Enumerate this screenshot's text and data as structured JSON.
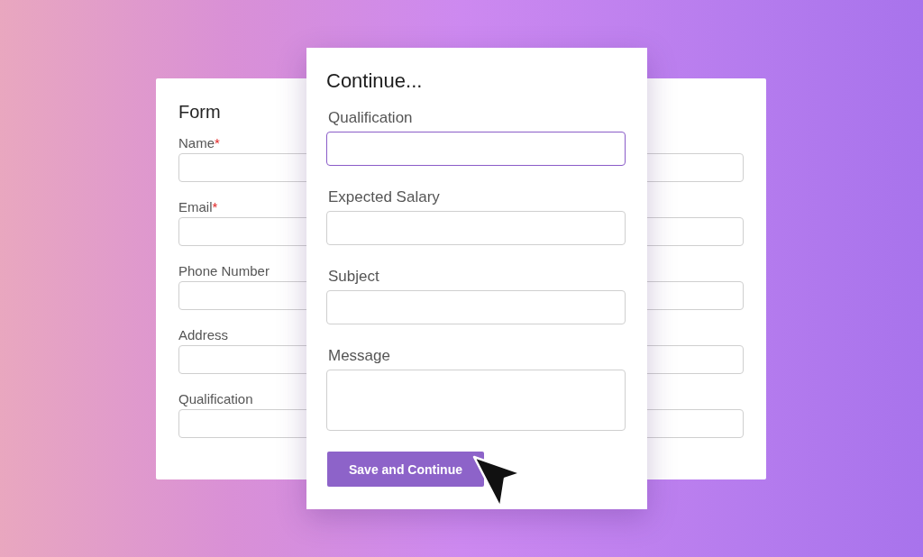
{
  "back_form": {
    "title": "Form",
    "fields": [
      {
        "label": "Name",
        "required_mark": "*"
      },
      {
        "label": "Email",
        "required_mark": "*"
      },
      {
        "label": "Phone Number"
      },
      {
        "label": "Address"
      },
      {
        "label": "Qualification"
      }
    ]
  },
  "front_form": {
    "title": "Continue...",
    "fields": [
      {
        "label": "Qualification",
        "kind": "input",
        "focused": true
      },
      {
        "label": "Expected Salary",
        "kind": "input",
        "focused": false
      },
      {
        "label": "Subject",
        "kind": "input",
        "focused": false
      },
      {
        "label": "Message",
        "kind": "textarea",
        "focused": false
      }
    ],
    "button": "Save and Continue"
  }
}
